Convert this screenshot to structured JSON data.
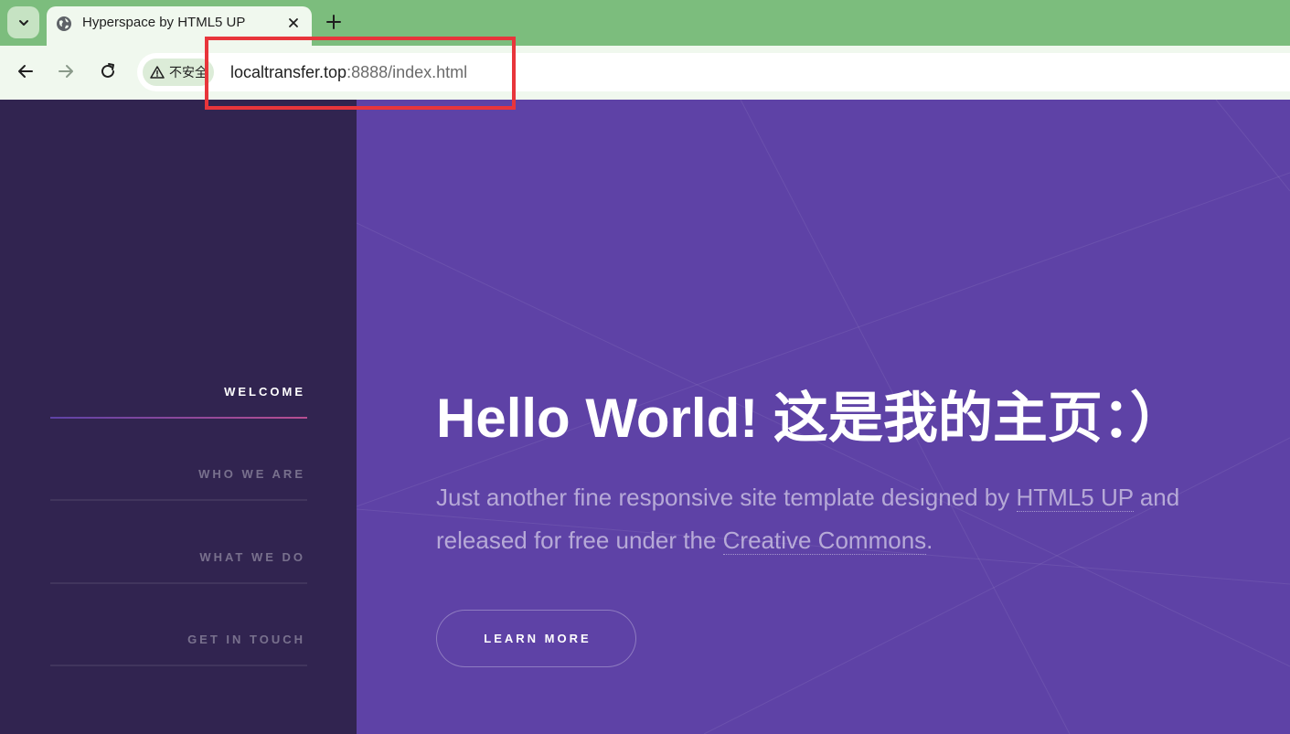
{
  "browser": {
    "tab_title": "Hyperspace by HTML5 UP",
    "security_label": "不安全",
    "url_host": "localtransfer.top",
    "url_rest": ":8888/index.html"
  },
  "sidebar": {
    "items": [
      {
        "label": "WELCOME",
        "active": true
      },
      {
        "label": "WHO WE ARE",
        "active": false
      },
      {
        "label": "WHAT WE DO",
        "active": false
      },
      {
        "label": "GET IN TOUCH",
        "active": false
      }
    ]
  },
  "hero": {
    "title": "Hello World! 这是我的主页：）",
    "text_part1": "Just another fine responsive site template designed by ",
    "link1": "HTML5 UP",
    "text_part2": " and released for free under the ",
    "link2": "Creative Commons",
    "text_part3": ".",
    "button_label": "LEARN MORE"
  },
  "colors": {
    "page_background": "#5e42a6",
    "sidebar_background": "#312450",
    "tabbar": "#7cbd7d",
    "annotation": "#e8353b"
  },
  "icons": [
    "tab-search-icon",
    "globe-icon",
    "close-icon",
    "plus-icon",
    "back-arrow-icon",
    "forward-arrow-icon",
    "reload-icon",
    "warning-triangle-icon"
  ]
}
